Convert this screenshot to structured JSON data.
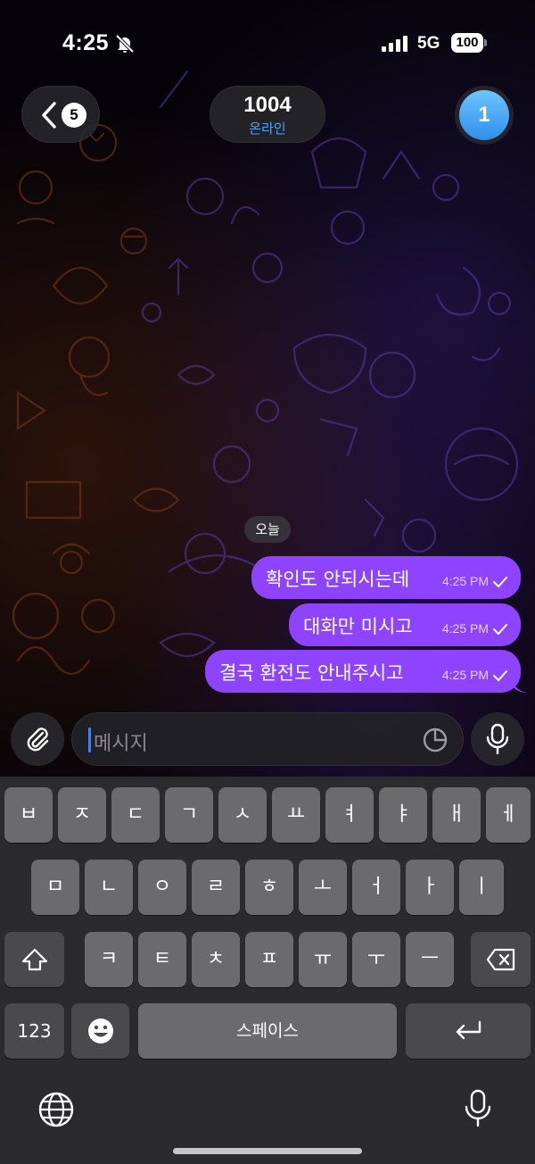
{
  "status_bar": {
    "time": "4:25",
    "network": "5G",
    "battery": "100"
  },
  "header": {
    "back_count": "5",
    "title": "1004",
    "status": "온라인",
    "avatar_initial": "1"
  },
  "chat": {
    "date_divider": "오늘",
    "messages": [
      {
        "text": "확인도 안되시는데",
        "time": "4:25 PM"
      },
      {
        "text": "대화만 미시고",
        "time": "4:25 PM"
      },
      {
        "text": "결국 환전도 안내주시고",
        "time": "4:25 PM"
      }
    ],
    "bubble_color": "#8e44ff"
  },
  "composer": {
    "placeholder": "메시지"
  },
  "keyboard": {
    "row1": [
      "ㅂ",
      "ㅈ",
      "ㄷ",
      "ㄱ",
      "ㅅ",
      "ㅛ",
      "ㅕ",
      "ㅑ",
      "ㅐ",
      "ㅔ"
    ],
    "row2": [
      "ㅁ",
      "ㄴ",
      "ㅇ",
      "ㄹ",
      "ㅎ",
      "ㅗ",
      "ㅓ",
      "ㅏ",
      "ㅣ"
    ],
    "row3": [
      "ㅋ",
      "ㅌ",
      "ㅊ",
      "ㅍ",
      "ㅠ",
      "ㅜ",
      "ㅡ"
    ],
    "numbers_label": "123",
    "space_label": "스페이스"
  },
  "icons": [
    "bell-slash-icon",
    "signal-icon",
    "chevron-left-icon",
    "paperclip-icon",
    "sticker-icon",
    "microphone-icon",
    "shift-icon",
    "delete-icon",
    "emoji-icon",
    "return-icon",
    "globe-icon",
    "dictation-icon",
    "read-check-icon"
  ]
}
